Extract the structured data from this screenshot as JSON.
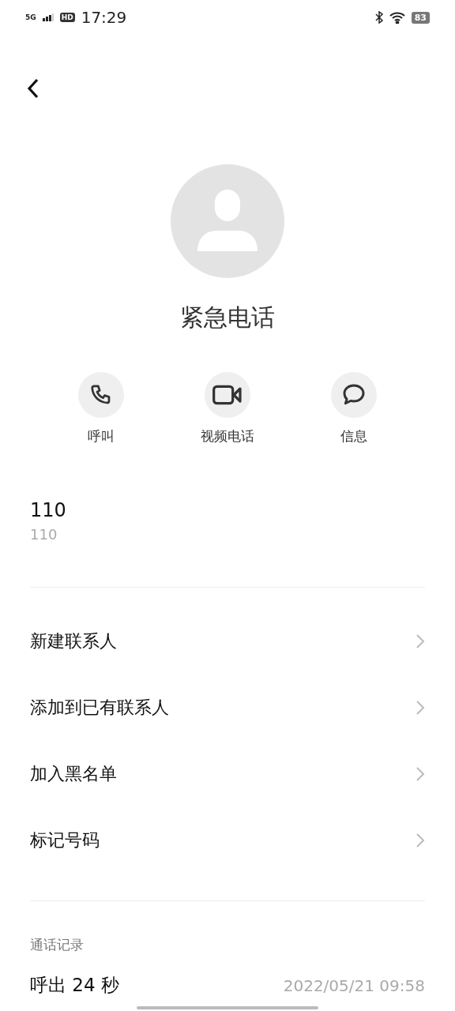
{
  "status_bar": {
    "network": "5G",
    "hd": "HD",
    "time": "17:29",
    "battery": "83"
  },
  "contact": {
    "name": "紧急电话"
  },
  "actions": [
    {
      "kind": "call",
      "label": "呼叫"
    },
    {
      "kind": "video",
      "label": "视频电话"
    },
    {
      "kind": "message",
      "label": "信息"
    }
  ],
  "number": {
    "value": "110",
    "subtitle": "110"
  },
  "menu": [
    "新建联系人",
    "添加到已有联系人",
    "加入黑名单",
    "标记号码"
  ],
  "call_log": {
    "title": "通话记录",
    "entries": [
      {
        "description": "呼出 24 秒",
        "time": "2022/05/21 09:58"
      }
    ]
  }
}
